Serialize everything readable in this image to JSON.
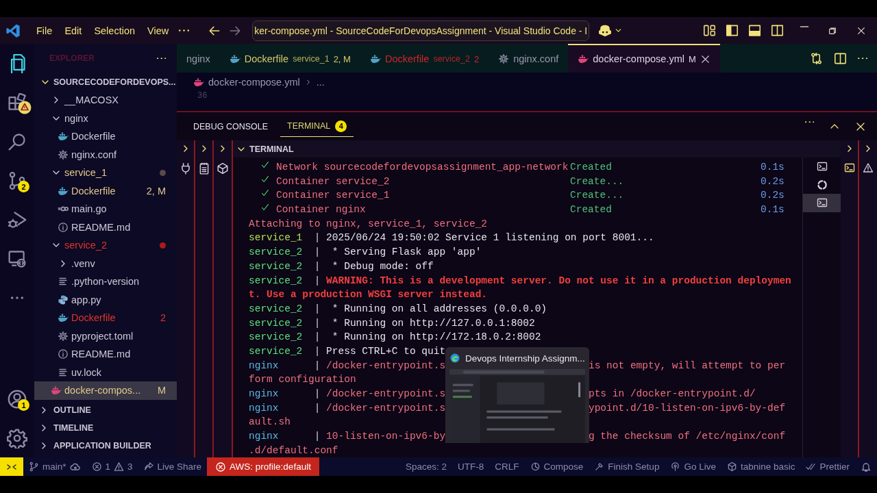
{
  "title_bar": {
    "menu": [
      "File",
      "Edit",
      "Selection",
      "View"
    ],
    "title": "ker-compose.yml - SourceCodeForDevopsAssignment - Visual Studio Code - I"
  },
  "activity_bar": {
    "items": [
      {
        "kind": "explorer",
        "selected": true
      },
      {
        "kind": "extensions",
        "selected": false,
        "warning": true
      },
      {
        "kind": "search",
        "selected": false
      },
      {
        "kind": "source_control",
        "selected": false,
        "badge": "2"
      },
      {
        "kind": "run_debug",
        "selected": false
      },
      {
        "kind": "remote",
        "selected": false
      },
      {
        "kind": "more",
        "selected": false
      }
    ],
    "bottom": [
      {
        "kind": "accounts",
        "badge": "1"
      },
      {
        "kind": "settings"
      }
    ]
  },
  "sidebar": {
    "title": "EXPLORER",
    "root": {
      "label": "SOURCECODEFORDEVOPS...",
      "expanded": true,
      "children": [
        {
          "label": "__MACOSX",
          "kind": "folder",
          "expanded": false,
          "selected": false,
          "modified": false,
          "errors": false
        },
        {
          "label": "nginx",
          "kind": "folder",
          "expanded": true,
          "selected": false,
          "modified": false,
          "errors": false,
          "children": [
            {
              "label": "Dockerfile",
              "kind": "docker",
              "selected": false,
              "modified": false,
              "errors": false
            },
            {
              "label": "nginx.conf",
              "kind": "config",
              "selected": false,
              "modified": false,
              "errors": false
            }
          ]
        },
        {
          "label": "service_1",
          "kind": "folder",
          "expanded": true,
          "selected": false,
          "modified": true,
          "errors": false,
          "dot": true,
          "children": [
            {
              "label": "Dockerfile",
              "kind": "docker",
              "selected": false,
              "modified": true,
              "errors": false,
              "badge": "2, M"
            },
            {
              "label": "main.go",
              "kind": "go",
              "selected": false,
              "modified": false,
              "errors": false
            },
            {
              "label": "README.md",
              "kind": "readme",
              "selected": false,
              "modified": false,
              "errors": false
            }
          ]
        },
        {
          "label": "service_2",
          "kind": "folder",
          "expanded": true,
          "selected": false,
          "modified": false,
          "errors": true,
          "dot": true,
          "children": [
            {
              "label": ".venv",
              "kind": "folder",
              "expanded": false,
              "selected": false,
              "modified": false,
              "errors": false
            },
            {
              "label": ".python-version",
              "kind": "text",
              "selected": false,
              "modified": false,
              "errors": false
            },
            {
              "label": "app.py",
              "kind": "python",
              "selected": false,
              "modified": false,
              "errors": false
            },
            {
              "label": "Dockerfile",
              "kind": "docker",
              "selected": false,
              "modified": false,
              "errors": true,
              "badge": "2"
            },
            {
              "label": "pyproject.toml",
              "kind": "config",
              "selected": false,
              "modified": false,
              "errors": false
            },
            {
              "label": "README.md",
              "kind": "readme",
              "selected": false,
              "modified": false,
              "errors": false
            },
            {
              "label": "uv.lock",
              "kind": "text",
              "selected": false,
              "modified": false,
              "errors": false
            }
          ]
        },
        {
          "label": "docker-compos...",
          "kind": "compose",
          "selected": true,
          "modified": true,
          "errors": false,
          "badge": "M"
        }
      ]
    },
    "sections": [
      {
        "label": "OUTLINE",
        "expanded": false
      },
      {
        "label": "TIMELINE",
        "expanded": false
      },
      {
        "label": "APPLICATION BUILDER",
        "expanded": false
      }
    ]
  },
  "editor": {
    "tabs": [
      {
        "label": "nginx",
        "kind": "plain",
        "selected": false,
        "modified": false,
        "errors": false
      },
      {
        "label": "Dockerfile",
        "description": "service_1",
        "badge": "2, M",
        "kind": "docker",
        "selected": false,
        "modified": true,
        "errors": false
      },
      {
        "label": "Dockerfile",
        "description": "service_2",
        "badge": "2",
        "kind": "docker",
        "selected": false,
        "modified": false,
        "errors": true
      },
      {
        "label": "nginx.conf",
        "kind": "config",
        "selected": false,
        "modified": false,
        "errors": false
      },
      {
        "label": "docker-compose.yml",
        "badge": "M",
        "kind": "compose",
        "selected": true,
        "modified": false,
        "errors": false
      }
    ],
    "breadcrumb": [
      "docker-compose.yml",
      "..."
    ],
    "line_number": "36"
  },
  "panel": {
    "tabs": [
      {
        "label": "DEBUG CONSOLE",
        "selected": false
      },
      {
        "label": "TERMINAL",
        "selected": true,
        "badge": "4"
      }
    ],
    "terminal_title": "TERMINAL",
    "terminal_tabs": [
      {
        "kind": "shell",
        "selected": false
      },
      {
        "kind": "ring",
        "selected": false
      },
      {
        "kind": "shell",
        "selected": true
      }
    ],
    "lines": [
      {
        "kind": "task",
        "text": "Network sourcecodefordevopsassignment_app-network",
        "status": "Created",
        "time": "0.1s"
      },
      {
        "kind": "task",
        "text": "Container service_2",
        "status": "Create...",
        "time": "0.2s"
      },
      {
        "kind": "task",
        "text": "Container service_1",
        "status": "Create...",
        "time": "0.2s"
      },
      {
        "kind": "task",
        "text": "Container nginx",
        "status": "Created",
        "time": "0.1s"
      },
      {
        "kind": "notice",
        "text": "Attaching to nginx, service_1, service_2"
      },
      {
        "kind": "log",
        "source": "service_1",
        "color": "#b5e04c",
        "separator": "|",
        "text": "2025/06/24 19:50:02 Service 1 listening on port 8001..."
      },
      {
        "kind": "log",
        "source": "service_2",
        "color": "#5fe07e",
        "separator": "|",
        "text": " * Serving Flask app 'app'"
      },
      {
        "kind": "log",
        "source": "service_2",
        "color": "#5fe07e",
        "separator": "|",
        "text": " * Debug mode: off"
      },
      {
        "kind": "log_warning",
        "source": "service_2",
        "color": "#5fe07e",
        "separator": "|",
        "text": "WARNING: This is a development server. Do not use it in a production deploymen"
      },
      {
        "kind": "wrap_warning",
        "text": "t. Use a production WSGI server instead."
      },
      {
        "kind": "log",
        "source": "service_2",
        "color": "#5fe07e",
        "separator": "|",
        "text": " * Running on all addresses (0.0.0.0)"
      },
      {
        "kind": "log",
        "source": "service_2",
        "color": "#5fe07e",
        "separator": "|",
        "text": " * Running on http://127.0.0.1:8002"
      },
      {
        "kind": "log",
        "source": "service_2",
        "color": "#5fe07e",
        "separator": "|",
        "text": " * Running on http://172.18.0.2:8002"
      },
      {
        "kind": "log",
        "source": "service_2",
        "color": "#5fe07e",
        "separator": "|",
        "text": "Press CTRL+C to quit"
      },
      {
        "kind": "log_stderr",
        "source": "nginx",
        "color": "#5ab8e6",
        "separator": "|",
        "text": "/docker-entrypoint.s",
        "tail": "is not empty, will attempt to per"
      },
      {
        "kind": "wrap_stderr",
        "text": "form configuration"
      },
      {
        "kind": "log_stderr",
        "source": "nginx",
        "color": "#5ab8e6",
        "separator": "|",
        "text": "/docker-entrypoint.s",
        "tail": "pts in /docker-entrypoint.d/"
      },
      {
        "kind": "log_stderr",
        "source": "nginx",
        "color": "#5ab8e6",
        "separator": "|",
        "text": "/docker-entrypoint.s",
        "tail": "ypoint.d/10-listen-on-ipv6-by-def"
      },
      {
        "kind": "wrap_stderr",
        "text": "ault.sh"
      },
      {
        "kind": "log_stderr",
        "source": "nginx",
        "color": "#5ab8e6",
        "separator": "|",
        "text": "10-listen-on-ipv6-by",
        "tail": "g the checksum of /etc/nginx/conf"
      },
      {
        "kind": "wrap_stderr",
        "text": ".d/default.conf"
      }
    ],
    "popup": {
      "title": "Devops Internship Assignm..."
    }
  },
  "status_bar": {
    "left": [
      {
        "kind": "remote"
      },
      {
        "kind": "branch",
        "text": "main*"
      },
      {
        "kind": "problems",
        "errors": "1",
        "warnings": "3"
      },
      {
        "kind": "live_share",
        "text": "Live Share"
      },
      {
        "kind": "aws",
        "text": "AWS: profile:default"
      }
    ],
    "right": [
      {
        "kind": "text",
        "text": "Spaces: 2"
      },
      {
        "kind": "text",
        "text": "UTF-8"
      },
      {
        "kind": "text",
        "text": "CRLF"
      },
      {
        "kind": "compose",
        "text": "Compose"
      },
      {
        "kind": "setup",
        "text": "Finish Setup"
      },
      {
        "kind": "go_live",
        "text": "Go Live"
      },
      {
        "kind": "tabnine",
        "text": "tabnine basic"
      },
      {
        "kind": "prettier",
        "text": "Prettier"
      },
      {
        "kind": "bell"
      }
    ]
  }
}
